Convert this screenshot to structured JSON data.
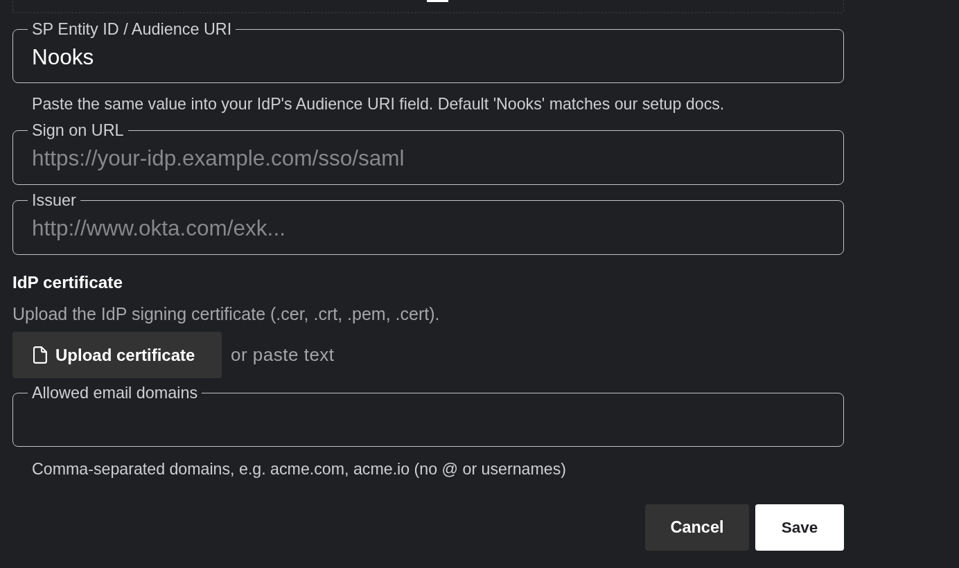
{
  "fields": [
    {
      "label": "SP Entity ID / Audience URI",
      "value": "Nooks",
      "helper": "Paste the same value into your IdP's Audience URI field. Default 'Nooks' matches our setup docs."
    },
    {
      "label": "Sign on URL",
      "placeholder": "https://your-idp.example.com/sso/saml"
    },
    {
      "label": "Issuer",
      "placeholder": "http://www.okta.com/exk..."
    }
  ],
  "certificate": {
    "title": "IdP certificate",
    "description": "Upload the IdP signing certificate (.cer, .crt, .pem, .cert).",
    "upload_button": "Upload certificate",
    "alternative": "or paste text"
  },
  "domains_field": {
    "label": "Allowed email domains",
    "helper": "Comma-separated domains, e.g. acme.com, acme.io (no @ or usernames)"
  },
  "actions": [
    {
      "label": "Cancel",
      "kind": "secondary"
    },
    {
      "label": "Save",
      "kind": "primary"
    }
  ]
}
